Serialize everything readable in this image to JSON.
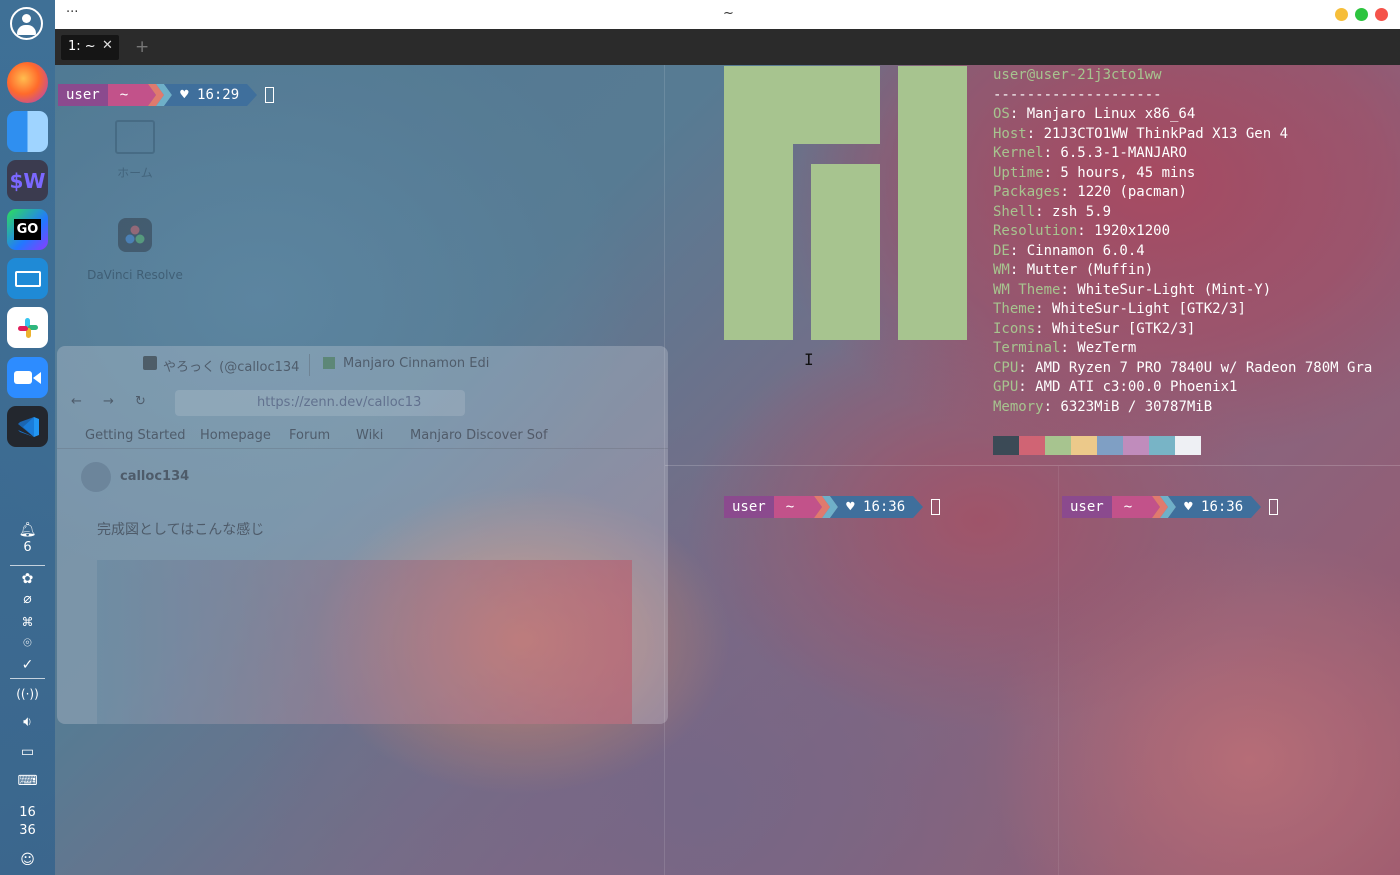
{
  "window": {
    "title": "~",
    "menu_dots": "···"
  },
  "tabs": [
    {
      "label": "1: ~"
    }
  ],
  "new_tab_symbol": "+",
  "dock": {
    "apps": [
      {
        "name": "Firefox",
        "icon": "firefox-icon"
      },
      {
        "name": "Finder",
        "icon": "finder-icon"
      },
      {
        "name": "WezTerm",
        "icon": "wezterm-icon",
        "label": "$W"
      },
      {
        "name": "GoLand",
        "icon": "goland-icon",
        "label": "GO"
      },
      {
        "name": "Remote Desktop",
        "icon": "remote-desktop-icon"
      },
      {
        "name": "Slack",
        "icon": "slack-icon"
      },
      {
        "name": "Zoom",
        "icon": "zoom-icon"
      },
      {
        "name": "VS Code",
        "icon": "vscode-icon"
      }
    ],
    "notification_count": "6",
    "clock": {
      "hour": "16",
      "minute": "36"
    }
  },
  "desktop": {
    "icons": [
      {
        "label": "ホーム"
      },
      {
        "label": "DaVinci Resolve"
      }
    ]
  },
  "prompts": {
    "top_left": {
      "user": "user",
      "dir": "~",
      "time": "♥ 16:29"
    },
    "bottom_left": {
      "user": "user",
      "dir": "~",
      "time": "♥ 16:36"
    },
    "bottom_right": {
      "user": "user",
      "dir": "~",
      "time": "♥ 16:36"
    }
  },
  "neofetch": {
    "userhost": "user@user-21j3cto1ww",
    "separator": "--------------------",
    "lines": [
      {
        "key": "OS",
        "value": ": Manjaro Linux x86_64"
      },
      {
        "key": "Host",
        "value": ": 21J3CTO1WW ThinkPad X13 Gen 4"
      },
      {
        "key": "Kernel",
        "value": ": 6.5.3-1-MANJARO"
      },
      {
        "key": "Uptime",
        "value": ": 5 hours, 45 mins"
      },
      {
        "key": "Packages",
        "value": ": 1220 (pacman)"
      },
      {
        "key": "Shell",
        "value": ": zsh 5.9"
      },
      {
        "key": "Resolution",
        "value": ": 1920x1200"
      },
      {
        "key": "DE",
        "value": ": Cinnamon 6.0.4"
      },
      {
        "key": "WM",
        "value": ": Mutter (Muffin)"
      },
      {
        "key": "WM Theme",
        "value": ": WhiteSur-Light (Mint-Y)"
      },
      {
        "key": "Theme",
        "value": ": WhiteSur-Light [GTK2/3]"
      },
      {
        "key": "Icons",
        "value": ": WhiteSur [GTK2/3]"
      },
      {
        "key": "Terminal",
        "value": ": WezTerm"
      },
      {
        "key": "CPU",
        "value": ": AMD Ryzen 7 PRO 7840U w/ Radeon 780M Gra"
      },
      {
        "key": "GPU",
        "value": ": AMD ATI c3:00.0 Phoenix1"
      },
      {
        "key": "Memory",
        "value": ": 6323MiB / 30787MiB"
      }
    ],
    "palette": [
      "#3b4a56",
      "#d06474",
      "#a7c48f",
      "#ecc98a",
      "#7f9fc4",
      "#c08cbc",
      "#78b4c6",
      "#eef0f4"
    ],
    "logo_color": "#a7c48f"
  },
  "ghost_browser": {
    "tab1": "やろっく (@calloc134",
    "tab2": "Manjaro Cinnamon Edi",
    "url": "https://zenn.dev/calloc13",
    "bookmarks": [
      "Getting Started",
      "Homepage",
      "Forum",
      "Wiki",
      "Manjaro Discover Sof"
    ],
    "author": "calloc134",
    "body_text": "完成図としてはこんな感じ"
  },
  "colors": {
    "prompt_user": "#8b4a8e",
    "prompt_dir": "#c2528a",
    "prompt_time": "#3f6f9c",
    "accent_green": "#a7c48f"
  }
}
